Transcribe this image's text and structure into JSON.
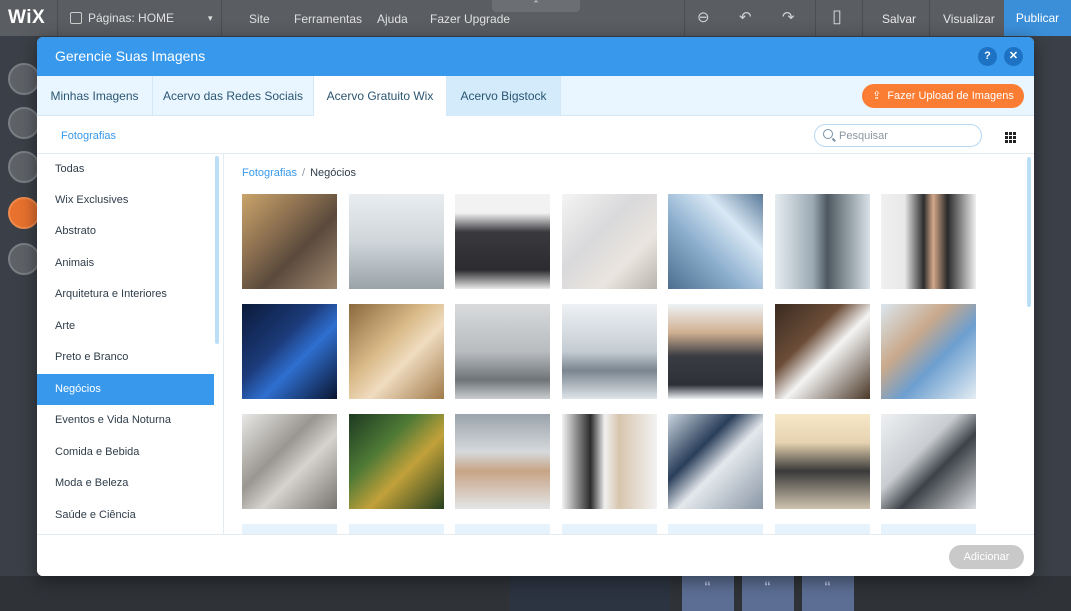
{
  "editor": {
    "logo": "WiX",
    "pages_label": "Páginas: HOME",
    "menu": [
      "Site",
      "Ferramentas",
      "Ajuda",
      "Fazer Upgrade"
    ],
    "save": "Salvar",
    "preview": "Visualizar",
    "publish": "Publicar"
  },
  "modal": {
    "title": "Gerencie Suas Imagens",
    "help": "?",
    "close": "✕",
    "tabs": [
      {
        "label": "Minhas Imagens"
      },
      {
        "label": "Acervo das Redes Sociais"
      },
      {
        "label": "Acervo Gratuito Wix"
      },
      {
        "label": "Acervo Bigstock"
      }
    ],
    "active_tab": "Acervo Bigstock",
    "upload_button": "Fazer Upload de Imagens",
    "section_title": "Fotografias",
    "search_placeholder": "Pesquisar",
    "categories": [
      "Todas",
      "Wix Exclusives",
      "Abstrato",
      "Animais",
      "Arquitetura e Interiores",
      "Arte",
      "Preto e Branco",
      "Negócios",
      "Eventos e Vida Noturna",
      "Comida e Bebida",
      "Moda e Beleza",
      "Saúde e Ciência"
    ],
    "selected_category": "Negócios",
    "breadcrumb": {
      "root": "Fotografias",
      "separator": "/",
      "current": "Negócios"
    },
    "add_button": "Adicionar"
  },
  "colors": {
    "accent": "#3899ec",
    "upload": "#fb7d33",
    "disabled": "#c9c9c9"
  }
}
